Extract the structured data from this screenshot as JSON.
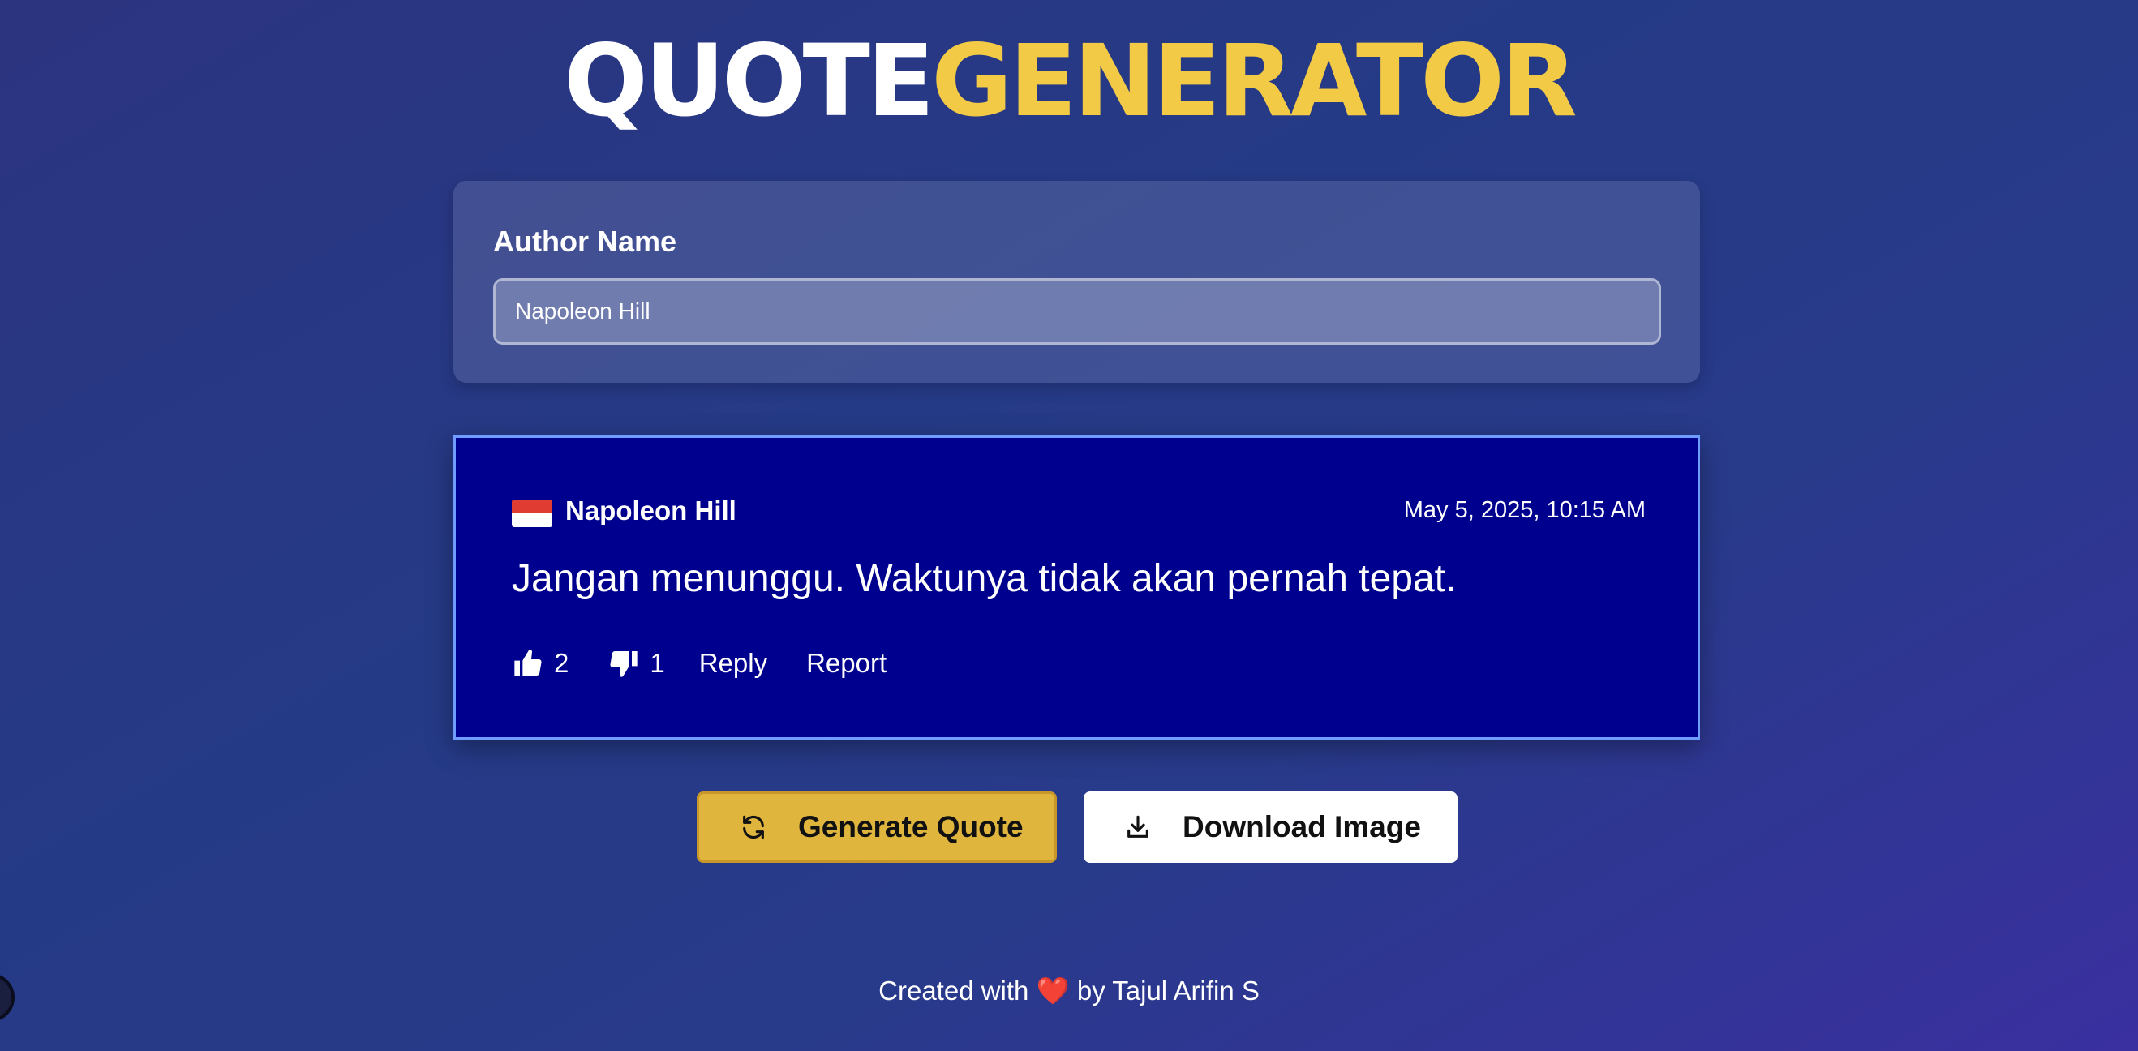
{
  "header": {
    "title_part1": "QUOTE",
    "title_part2": "GENERATOR"
  },
  "author_form": {
    "label": "Author Name",
    "input_value": "Napoleon Hill"
  },
  "quote_card": {
    "flag_icon": "indonesia-flag-icon",
    "author": "Napoleon Hill",
    "datetime": "May 5, 2025, 10:15 AM",
    "text": "Jangan menunggu. Waktunya tidak akan pernah tepat.",
    "likes": "2",
    "dislikes": "1",
    "reply_label": "Reply",
    "report_label": "Report"
  },
  "buttons": {
    "generate_label": "Generate Quote",
    "generate_icon": "refresh-icon",
    "download_label": "Download Image",
    "download_icon": "download-icon"
  },
  "footer": {
    "prefix": "Created with",
    "heart": "❤️",
    "suffix": "by Tajul Arifin S"
  },
  "colors": {
    "accent_yellow": "#f2ca46",
    "card_bg": "#00008e",
    "card_border": "#6f9cff",
    "generate_button": "#e0b53d"
  }
}
